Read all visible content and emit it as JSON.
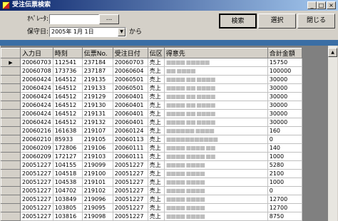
{
  "window": {
    "title": "受注伝票検索",
    "minimize": "_",
    "maximize": "□",
    "close": "×"
  },
  "form": {
    "operator_label": "ｵﾍﾟﾚｰﾀ:",
    "operator_value": "",
    "browse_button": "...",
    "date_label": "保守日:",
    "date_value": "2005年 1月 1日",
    "date_suffix": "から"
  },
  "buttons": {
    "search": "検索",
    "select": "選択",
    "close": "閉じる"
  },
  "table": {
    "columns": [
      "入力日",
      "時刻",
      "伝票No.",
      "受注日付",
      "伝区",
      "得意先",
      "合計金額"
    ],
    "current_row_marker": "▶",
    "rows": [
      [
        "20060703",
        "112541",
        "237184",
        "20060703",
        "売上",
        "■■■■ ■■■■■",
        "15750"
      ],
      [
        "20060708",
        "173736",
        "237187",
        "20060604",
        "売上",
        "■■ ■■■■",
        "100000"
      ],
      [
        "20060424",
        "164512",
        "219135",
        "20060501",
        "売上",
        "■■■■ ■■ ■■■■",
        "30000"
      ],
      [
        "20060424",
        "164512",
        "219133",
        "20060501",
        "売上",
        "■■■■ ■■ ■■■■",
        "30000"
      ],
      [
        "20060424",
        "164512",
        "219129",
        "20060401",
        "売上",
        "■■■■ ■■ ■■■■",
        "30000"
      ],
      [
        "20060424",
        "164512",
        "219130",
        "20060401",
        "売上",
        "■■■■ ■■ ■■■■",
        "30000"
      ],
      [
        "20060424",
        "164512",
        "219131",
        "20060401",
        "売上",
        "■■■■ ■■ ■■■■",
        "30000"
      ],
      [
        "20060424",
        "164512",
        "219132",
        "20060401",
        "売上",
        "■■■■ ■■ ■■■■",
        "30000"
      ],
      [
        "20060216",
        "161638",
        "219107",
        "20060124",
        "売上",
        "■■■■■■ ■■■■",
        "160"
      ],
      [
        "20060210",
        "85933",
        "219105",
        "20060113",
        "売上",
        "■■■■■■■■■■■",
        "0"
      ],
      [
        "20060209",
        "172806",
        "219106",
        "20060111",
        "売上",
        "■■■■ ■■■■ ■■",
        "140"
      ],
      [
        "20060209",
        "172127",
        "219103",
        "20060111",
        "売上",
        "■■■■ ■■■■ ■■",
        "1000"
      ],
      [
        "20051227",
        "104155",
        "219099",
        "20051227",
        "売上",
        "■■■■ ■■■■",
        "5280"
      ],
      [
        "20051227",
        "104518",
        "219100",
        "20051227",
        "売上",
        "■■■■ ■■■■",
        "2100"
      ],
      [
        "20051227",
        "104538",
        "219101",
        "20051227",
        "売上",
        "■■■■ ■■■■",
        "1000"
      ],
      [
        "20051227",
        "104702",
        "219102",
        "20051227",
        "売上",
        "■■■■ ■■■■",
        "0"
      ],
      [
        "20051227",
        "103849",
        "219096",
        "20051227",
        "売上",
        "■■■■ ■■■■",
        "12700"
      ],
      [
        "20051227",
        "103805",
        "219095",
        "20051227",
        "売上",
        "■■■■ ■■■■",
        "12700"
      ],
      [
        "20051227",
        "103816",
        "219098",
        "20051227",
        "売上",
        "■■■■ ■■■■",
        "8750"
      ],
      [
        "20051227",
        "103834",
        "219097",
        "20051227",
        "売上",
        "■■■■ ■■■■",
        "25400"
      ]
    ]
  },
  "scrollbar": {
    "up": "▲"
  }
}
